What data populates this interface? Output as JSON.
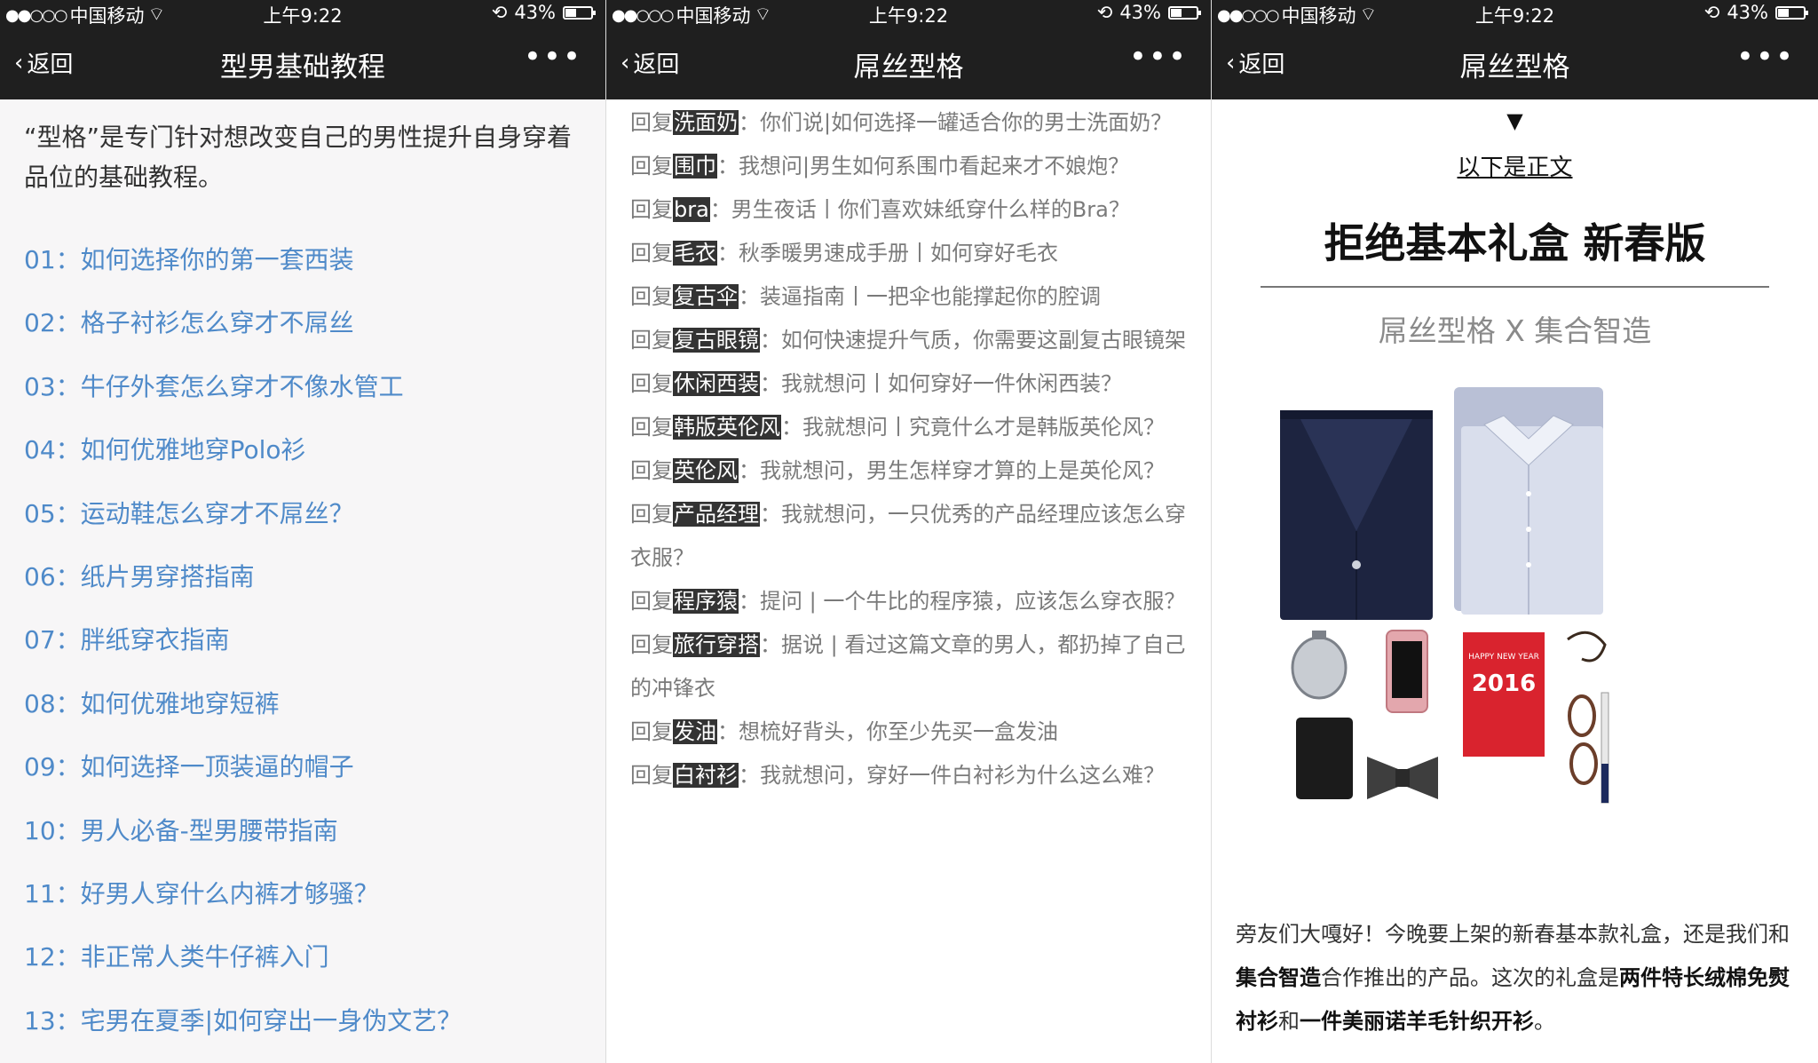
{
  "status": {
    "carrier": "中国移动",
    "time": "上午9:22",
    "battery": "43%",
    "battery_level": 0.43
  },
  "panel1": {
    "nav": {
      "back": "返回",
      "title": "型男基础教程",
      "more": "•••"
    },
    "intro": "“型格”是专门针对想改变自己的男性提升自身穿着品位的基础教程。",
    "items": [
      "01：如何选择你的第一套西装",
      "02：格子衬衫怎么穿才不屌丝",
      "03：牛仔外套怎么穿才不像水管工",
      "04：如何优雅地穿Polo衫",
      "05：运动鞋怎么穿才不屌丝？",
      "06：纸片男穿搭指南",
      "07：胖纸穿衣指南",
      "08：如何优雅地穿短裤",
      "09：如何选择一顶装逼的帽子",
      "10：男人必备-型男腰带指南",
      "11：好男人穿什么内裤才够骚？",
      "12：非正常人类牛仔裤入门",
      "13：宅男在夏季|如何穿出一身伪文艺？"
    ]
  },
  "panel2": {
    "nav": {
      "back": "返回",
      "title": "屌丝型格",
      "more": "•••"
    },
    "prefix": "回复",
    "replies": [
      {
        "keyword": "洗面奶",
        "text": "：你们说|如何选择一罐适合你的男士洗面奶？"
      },
      {
        "keyword": "围巾",
        "text": "：我想问|男生如何系围巾看起来才不娘炮？"
      },
      {
        "keyword": "bra",
        "text": "：男生夜话丨你们喜欢妹纸穿什么样的Bra？"
      },
      {
        "keyword": "毛衣",
        "text": "：秋季暖男速成手册丨如何穿好毛衣"
      },
      {
        "keyword": "复古伞",
        "text": "：装逼指南丨一把伞也能撑起你的腔调"
      },
      {
        "keyword": "复古眼镜",
        "text": "：如何快速提升气质，你需要这副复古眼镜架"
      },
      {
        "keyword": "休闲西装",
        "text": "：我就想问丨如何穿好一件休闲西装？"
      },
      {
        "keyword": "韩版英伦风",
        "text": "：我就想问丨究竟什么才是韩版英伦风？"
      },
      {
        "keyword": "英伦风",
        "text": "：我就想问，男生怎样穿才算的上是英伦风？"
      },
      {
        "keyword": "产品经理",
        "text": "：我就想问，一只优秀的产品经理应该怎么穿衣服？"
      },
      {
        "keyword": "程序猿",
        "text": "：提问 | 一个牛比的程序猿，应该怎么穿衣服？"
      },
      {
        "keyword": "旅行穿搭",
        "text": "：据说 | 看过这篇文章的男人，都扔掉了自己的冲锋衣"
      },
      {
        "keyword": "发油",
        "text": "：想梳好背头，你至少先买一盒发油"
      },
      {
        "keyword": "白衬衫",
        "text": "：我就想问，穿好一件白衬衫为什么这么难？"
      }
    ]
  },
  "panel3": {
    "nav": {
      "back": "返回",
      "title": "屌丝型格",
      "more": "•••"
    },
    "arrow": "▼",
    "subtitle": "以下是正文",
    "banner_title": "拒绝基本礼盒 新春版",
    "banner_sub": "屌丝型格 X 集合智造",
    "image": {
      "card_line1": "HAPPY NEW YEAR",
      "card_year": "2016"
    },
    "body": {
      "p1": "旁友们大嘎好！今晚要上架的新春基本款礼盒，还是我们和",
      "b1": "集合智造",
      "p2": "合作推出的产品。这次的礼盒是",
      "b2": "两件特长绒棉免熨衬衫",
      "p3": "和",
      "b3": "一件美丽诺羊毛针织开衫",
      "p4": "。"
    }
  }
}
